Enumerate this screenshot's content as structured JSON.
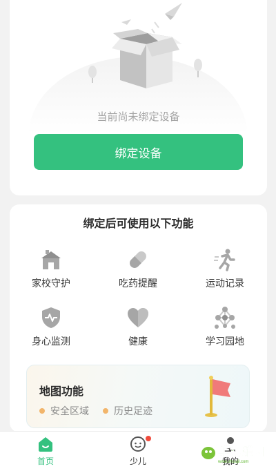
{
  "empty_state": {
    "message": "当前尚未绑定设备",
    "bind_button": "绑定设备"
  },
  "features": {
    "title": "绑定后可使用以下功能",
    "items": [
      {
        "label": "家校守护",
        "icon": "school-icon"
      },
      {
        "label": "吃药提醒",
        "icon": "pill-icon"
      },
      {
        "label": "运动记录",
        "icon": "runner-icon"
      },
      {
        "label": "身心监测",
        "icon": "shield-pulse-icon"
      },
      {
        "label": "健康",
        "icon": "heart-icon"
      },
      {
        "label": "学习园地",
        "icon": "network-icon"
      }
    ]
  },
  "map": {
    "title": "地图功能",
    "items": [
      "安全区域",
      "历史足迹"
    ]
  },
  "nav": {
    "items": [
      {
        "label": "首页",
        "active": true
      },
      {
        "label": "少儿",
        "badge": true
      },
      {
        "label": "我的"
      }
    ]
  },
  "watermark": {
    "text": "手机乐园",
    "url": "www.shoujil.com"
  },
  "colors": {
    "accent": "#34c17f",
    "badge": "#f04a3b",
    "dot": "#f2b56b",
    "icon": "#a6a6a6"
  }
}
